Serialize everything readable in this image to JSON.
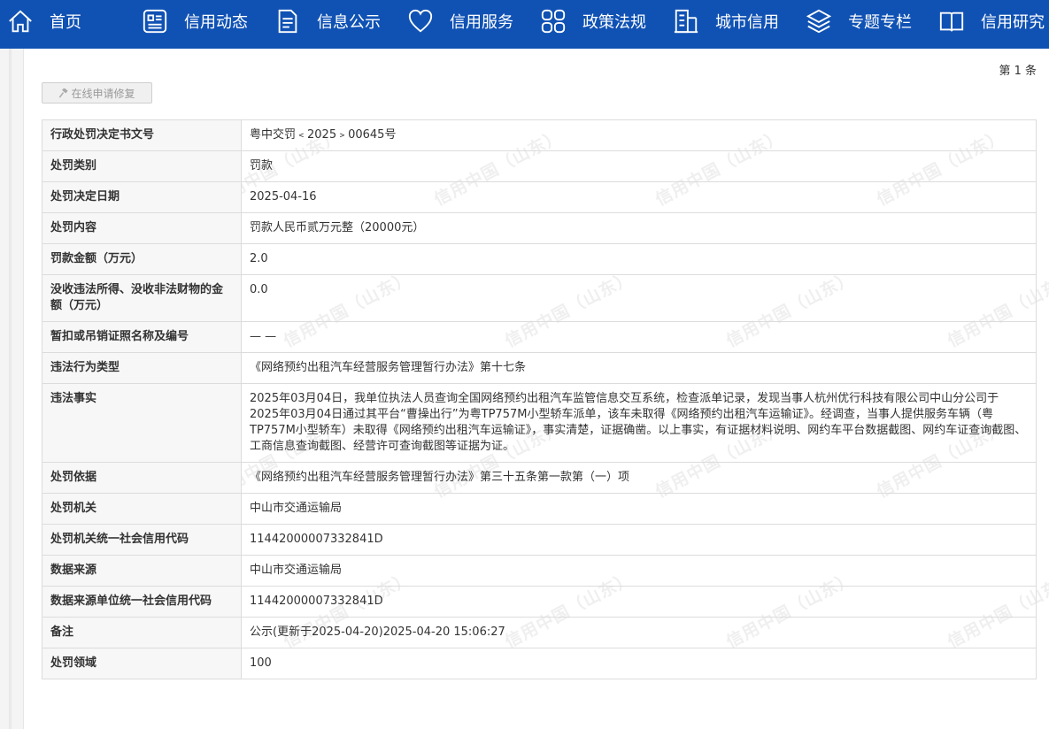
{
  "nav": {
    "items": [
      {
        "label": "首页",
        "icon": "home-icon"
      },
      {
        "label": "信用动态",
        "icon": "newsfeed-icon"
      },
      {
        "label": "信息公示",
        "icon": "document-icon"
      },
      {
        "label": "信用服务",
        "icon": "heart-icon"
      },
      {
        "label": "政策法规",
        "icon": "grid-icon"
      },
      {
        "label": "城市信用",
        "icon": "building-icon"
      },
      {
        "label": "专题专栏",
        "icon": "layers-icon"
      },
      {
        "label": "信用研究",
        "icon": "book-icon"
      }
    ]
  },
  "page": {
    "count_label": "第 1 条",
    "repair_button_label": "在线申请修复",
    "watermark_text": "信用中国（山东）"
  },
  "rows": [
    {
      "label": "行政处罚决定书文号",
      "value": "粤中交罚﹤2025﹥00645号"
    },
    {
      "label": "处罚类别",
      "value": "罚款"
    },
    {
      "label": "处罚决定日期",
      "value": "2025-04-16"
    },
    {
      "label": "处罚内容",
      "value": "罚款人民币贰万元整（20000元）"
    },
    {
      "label": "罚款金额（万元）",
      "value": "2.0"
    },
    {
      "label": "没收违法所得、没收非法财物的金额（万元）",
      "value": "0.0"
    },
    {
      "label": "暂扣或吊销证照名称及编号",
      "value": "— —"
    },
    {
      "label": "违法行为类型",
      "value": "《网络预约出租汽车经营服务管理暂行办法》第十七条"
    },
    {
      "label": "违法事实",
      "value": "2025年03月04日，我单位执法人员查询全国网络预约出租汽车监管信息交互系统，检查派单记录，发现当事人杭州优行科技有限公司中山分公司于2025年03月04日通过其平台“曹操出行”为粤TP757M小型轿车派单，该车未取得《网络预约出租汽车运输证》。经调查，当事人提供服务车辆（粤TP757M小型轿车）未取得《网络预约出租汽车运输证》，事实清楚，证据确凿。以上事实，有证据材料说明、网约车平台数据截图、网约车证查询截图、工商信息查询截图、经营许可查询截图等证据为证。"
    },
    {
      "label": "处罚依据",
      "value": "《网络预约出租汽车经营服务管理暂行办法》第三十五条第一款第（一）项"
    },
    {
      "label": "处罚机关",
      "value": "中山市交通运输局"
    },
    {
      "label": "处罚机关统一社会信用代码",
      "value": "11442000007332841D"
    },
    {
      "label": "数据来源",
      "value": "中山市交通运输局"
    },
    {
      "label": "数据来源单位统一社会信用代码",
      "value": "11442000007332841D"
    },
    {
      "label": "备注",
      "value": "公示(更新于2025-04-20)2025-04-20 15:06:27"
    },
    {
      "label": "处罚领域",
      "value": "100"
    }
  ]
}
